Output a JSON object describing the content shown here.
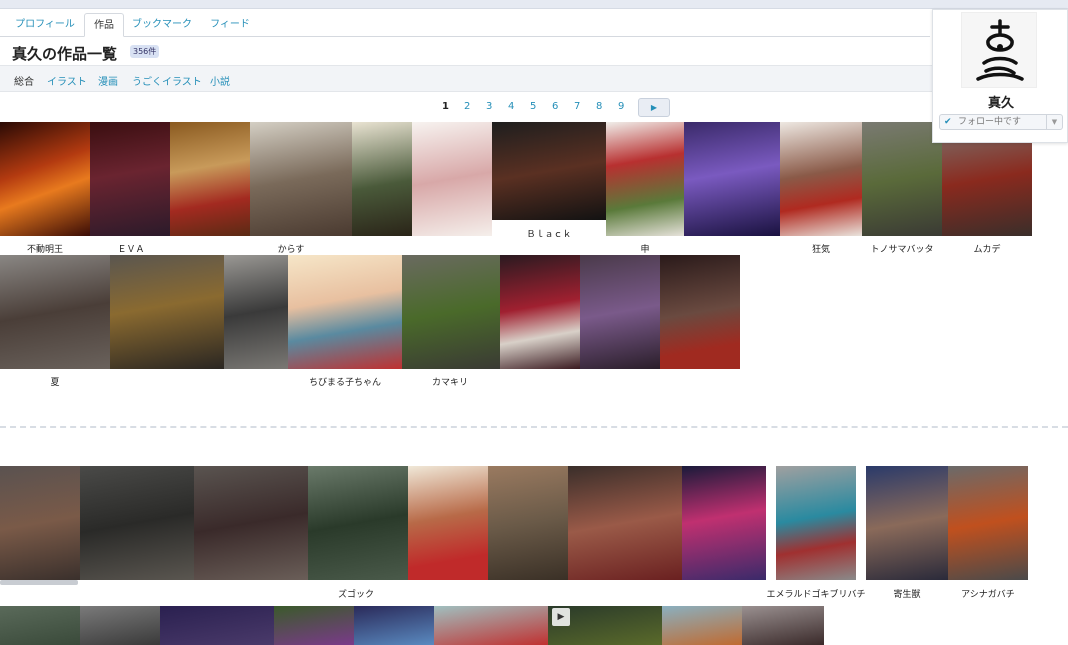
{
  "tabs": [
    {
      "label": "プロフィール"
    },
    {
      "label": "作品"
    },
    {
      "label": "ブックマーク"
    },
    {
      "label": "フィード"
    }
  ],
  "header": {
    "title": "真久の作品一覧",
    "count": "356件"
  },
  "subnav": [
    {
      "label": "総合"
    },
    {
      "label": "イラスト"
    },
    {
      "label": "漫画"
    },
    {
      "label": "うごくイラスト"
    },
    {
      "label": "小説"
    }
  ],
  "pager": {
    "pages": [
      "1",
      "2",
      "3",
      "4",
      "5",
      "6",
      "7",
      "8",
      "9"
    ],
    "current": "1",
    "next": "▶"
  },
  "profile": {
    "name": "真久",
    "follow_label": "フォロー中です"
  },
  "captions": {
    "c1": "不動明王",
    "c2": "ＥＶＡ",
    "c3": "からす",
    "c4": "Ｂｌａｃｋ",
    "c5": "申",
    "c6": "狂気",
    "c7": "トノサマバッタ",
    "c8": "ムカデ",
    "c9": "夏",
    "c10": "ちびまる子ちゃん",
    "c11": "カマキリ",
    "c12": "ズゴック",
    "c13": "エメラルドゴキブリバチ",
    "c14": "寄生獣",
    "c15": "アシナガバチ"
  },
  "colors": {
    "link": "#258fb8",
    "accent_bar": "#e6eaf2"
  }
}
